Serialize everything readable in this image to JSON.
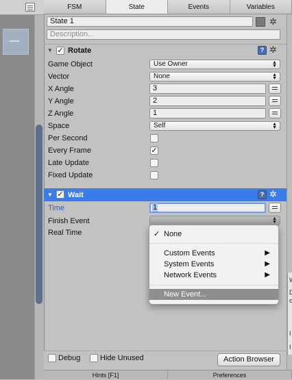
{
  "tabs": [
    "FSM",
    "State",
    "Events",
    "Variables"
  ],
  "state": {
    "name": "State 1",
    "description_placeholder": "Description..."
  },
  "rotate": {
    "title": "Rotate",
    "rows": [
      {
        "label": "Game Object",
        "type": "dropdown",
        "value": "Use Owner"
      },
      {
        "label": "Vector",
        "type": "dropdown",
        "value": "None"
      },
      {
        "label": "X Angle",
        "type": "number",
        "value": "3"
      },
      {
        "label": "Y Angle",
        "type": "number",
        "value": "2"
      },
      {
        "label": "Z Angle",
        "type": "number",
        "value": "1"
      },
      {
        "label": "Space",
        "type": "dropdown",
        "value": "Self"
      },
      {
        "label": "Per Second",
        "type": "check",
        "checked": false
      },
      {
        "label": "Every Frame",
        "type": "check",
        "checked": true
      },
      {
        "label": "Late Update",
        "type": "check",
        "checked": false
      },
      {
        "label": "Fixed Update",
        "type": "check",
        "checked": false
      }
    ]
  },
  "wait": {
    "title": "Wait",
    "time_label": "Time",
    "time_value": "1",
    "finish_event_label": "Finish Event",
    "finish_event_value": "",
    "real_time_label": "Real Time"
  },
  "popup": {
    "none_check": "✓",
    "none": "None",
    "custom_events": "Custom Events",
    "system_events": "System Events",
    "network_events": "Network Events",
    "new_event": "New Event...",
    "submenu_arrow": "▶"
  },
  "bottom": {
    "debug": "Debug",
    "hide_unused": "Hide Unused",
    "action_browser": "Action Browser"
  },
  "footer": [
    "Hints [F1]",
    "Preferences"
  ],
  "edge_panel": [
    "W",
    "D",
    "c",
    "I",
    "I"
  ],
  "colors": {
    "selection": "#3a7ce8",
    "popup_highlight": "#8e8e8e"
  },
  "icons": {
    "gear": "✲",
    "help": "?",
    "check": "✓",
    "fold": "▼",
    "arrows_up": "▲",
    "arrows_down": "▼"
  }
}
